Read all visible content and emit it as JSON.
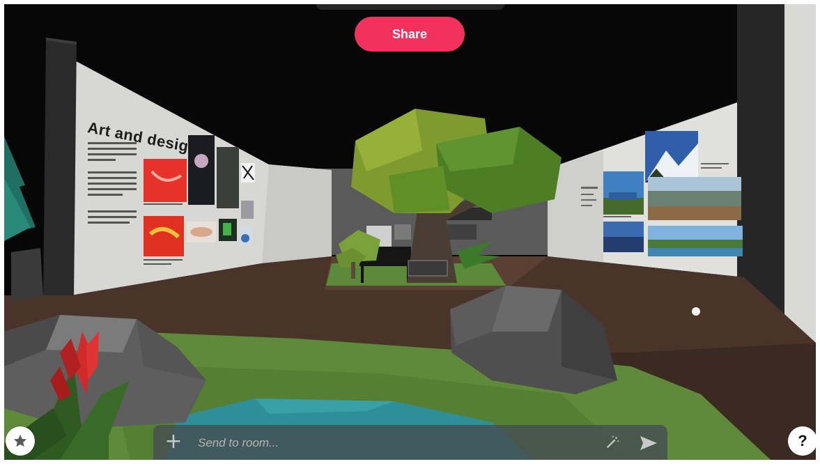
{
  "toolbar": {
    "share_label": "Share"
  },
  "gallery": {
    "wall_title": "Art and design"
  },
  "chat": {
    "placeholder": "Send to room..."
  },
  "help": {
    "label": "?"
  },
  "icons": {
    "favorite": "star-icon",
    "add": "plus-icon",
    "magic": "magic-wand-icon",
    "send": "send-icon",
    "help": "question-mark-icon"
  },
  "colors": {
    "share_button": "#f2325c",
    "chat_bar": "#464e52",
    "background": "#070707"
  }
}
